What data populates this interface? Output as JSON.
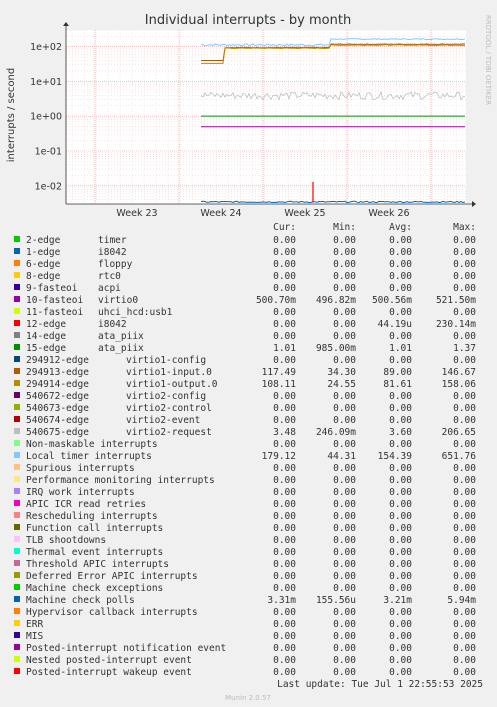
{
  "chart_data": {
    "type": "line",
    "title": "Individual interrupts - by month",
    "ylabel": "interrupts / second",
    "yscale": "log",
    "ylim": [
      0.003,
      300
    ],
    "y_ticks": [
      "1e+02",
      "1e+01",
      "1e+00",
      "1e-01",
      "1e-02"
    ],
    "x_ticks": [
      "Week 23",
      "Week 24",
      "Week 25",
      "Week 26"
    ],
    "side_label": "RRDTOOL / TOBI OETIKER",
    "column_headers": [
      "Cur:",
      "Min:",
      "Avg:",
      "Max:"
    ],
    "series": [
      {
        "name": "2-edge",
        "device": "timer",
        "color": "#00cc00",
        "cur": "0.00",
        "min": "0.00",
        "avg": "0.00",
        "max": "0.00"
      },
      {
        "name": "1-edge",
        "device": "i8042",
        "color": "#0066b3",
        "cur": "0.00",
        "min": "0.00",
        "avg": "0.00",
        "max": "0.00"
      },
      {
        "name": "6-edge",
        "device": "floppy",
        "color": "#ff8000",
        "cur": "0.00",
        "min": "0.00",
        "avg": "0.00",
        "max": "0.00"
      },
      {
        "name": "8-edge",
        "device": "rtc0",
        "color": "#ffcc00",
        "cur": "0.00",
        "min": "0.00",
        "avg": "0.00",
        "max": "0.00"
      },
      {
        "name": "9-fasteoi",
        "device": "acpi",
        "color": "#330099",
        "cur": "0.00",
        "min": "0.00",
        "avg": "0.00",
        "max": "0.00"
      },
      {
        "name": "10-fasteoi",
        "device": "virtio0",
        "color": "#990099",
        "cur": "500.70m",
        "min": "496.82m",
        "avg": "500.56m",
        "max": "521.50m"
      },
      {
        "name": "11-fasteoi",
        "device": "uhci_hcd:usb1",
        "color": "#ccff00",
        "cur": "0.00",
        "min": "0.00",
        "avg": "0.00",
        "max": "0.00"
      },
      {
        "name": "12-edge",
        "device": "i8042",
        "color": "#ff0000",
        "cur": "0.00",
        "min": "0.00",
        "avg": "44.19u",
        "max": "230.14m"
      },
      {
        "name": "14-edge",
        "device": "ata_piix",
        "color": "#808080",
        "cur": "0.00",
        "min": "0.00",
        "avg": "0.00",
        "max": "0.00"
      },
      {
        "name": "15-edge",
        "device": "ata_piix",
        "color": "#008f00",
        "cur": "1.01",
        "min": "985.00m",
        "avg": "1.01",
        "max": "1.37"
      },
      {
        "name": "294912-edge",
        "device": "virtio1-config",
        "color": "#00487d",
        "cur": "0.00",
        "min": "0.00",
        "avg": "0.00",
        "max": "0.00"
      },
      {
        "name": "294913-edge",
        "device": "virtio1-input.0",
        "color": "#b35a00",
        "cur": "117.49",
        "min": "34.30",
        "avg": "89.00",
        "max": "146.67"
      },
      {
        "name": "294914-edge",
        "device": "virtio1-output.0",
        "color": "#b38f00",
        "cur": "108.11",
        "min": "24.55",
        "avg": "81.61",
        "max": "158.06"
      },
      {
        "name": "540672-edge",
        "device": "virtio2-config",
        "color": "#6b006b",
        "cur": "0.00",
        "min": "0.00",
        "avg": "0.00",
        "max": "0.00"
      },
      {
        "name": "540673-edge",
        "device": "virtio2-control",
        "color": "#8fb300",
        "cur": "0.00",
        "min": "0.00",
        "avg": "0.00",
        "max": "0.00"
      },
      {
        "name": "540674-edge",
        "device": "virtio2-event",
        "color": "#b30000",
        "cur": "0.00",
        "min": "0.00",
        "avg": "0.00",
        "max": "0.00"
      },
      {
        "name": "540675-edge",
        "device": "virtio2-request",
        "color": "#bebebe",
        "cur": "3.48",
        "min": "246.09m",
        "avg": "3.60",
        "max": "206.65"
      },
      {
        "name": "Non-maskable interrupts",
        "device": "",
        "color": "#80ff80",
        "cur": "0.00",
        "min": "0.00",
        "avg": "0.00",
        "max": "0.00"
      },
      {
        "name": "Local timer interrupts",
        "device": "",
        "color": "#80c9ff",
        "cur": "179.12",
        "min": "44.31",
        "avg": "154.39",
        "max": "651.76"
      },
      {
        "name": "Spurious interrupts",
        "device": "",
        "color": "#ffc080",
        "cur": "0.00",
        "min": "0.00",
        "avg": "0.00",
        "max": "0.00"
      },
      {
        "name": "Performance monitoring interrupts",
        "device": "",
        "color": "#ffe680",
        "cur": "0.00",
        "min": "0.00",
        "avg": "0.00",
        "max": "0.00"
      },
      {
        "name": "IRQ work interrupts",
        "device": "",
        "color": "#aa80ff",
        "cur": "0.00",
        "min": "0.00",
        "avg": "0.00",
        "max": "0.00"
      },
      {
        "name": "APIC ICR read retries",
        "device": "",
        "color": "#ee00cc",
        "cur": "0.00",
        "min": "0.00",
        "avg": "0.00",
        "max": "0.00"
      },
      {
        "name": "Rescheduling interrupts",
        "device": "",
        "color": "#ff8080",
        "cur": "0.00",
        "min": "0.00",
        "avg": "0.00",
        "max": "0.00"
      },
      {
        "name": "Function call interrupts",
        "device": "",
        "color": "#666600",
        "cur": "0.00",
        "min": "0.00",
        "avg": "0.00",
        "max": "0.00"
      },
      {
        "name": "TLB shootdowns",
        "device": "",
        "color": "#ffbfff",
        "cur": "0.00",
        "min": "0.00",
        "avg": "0.00",
        "max": "0.00"
      },
      {
        "name": "Thermal event interrupts",
        "device": "",
        "color": "#00ffcc",
        "cur": "0.00",
        "min": "0.00",
        "avg": "0.00",
        "max": "0.00"
      },
      {
        "name": "Threshold APIC interrupts",
        "device": "",
        "color": "#cc6699",
        "cur": "0.00",
        "min": "0.00",
        "avg": "0.00",
        "max": "0.00"
      },
      {
        "name": "Deferred Error APIC interrupts",
        "device": "",
        "color": "#999900",
        "cur": "0.00",
        "min": "0.00",
        "avg": "0.00",
        "max": "0.00"
      },
      {
        "name": "Machine check exceptions",
        "device": "",
        "color": "#00cc00",
        "cur": "0.00",
        "min": "0.00",
        "avg": "0.00",
        "max": "0.00"
      },
      {
        "name": "Machine check polls",
        "device": "",
        "color": "#0066b3",
        "cur": "3.31m",
        "min": "155.56u",
        "avg": "3.21m",
        "max": "5.94m"
      },
      {
        "name": "Hypervisor callback interrupts",
        "device": "",
        "color": "#ff8000",
        "cur": "0.00",
        "min": "0.00",
        "avg": "0.00",
        "max": "0.00"
      },
      {
        "name": "ERR",
        "device": "",
        "color": "#ffcc00",
        "cur": "0.00",
        "min": "0.00",
        "avg": "0.00",
        "max": "0.00"
      },
      {
        "name": "MIS",
        "device": "",
        "color": "#330099",
        "cur": "0.00",
        "min": "0.00",
        "avg": "0.00",
        "max": "0.00"
      },
      {
        "name": "Posted-interrupt notification event",
        "device": "",
        "color": "#990099",
        "cur": "0.00",
        "min": "0.00",
        "avg": "0.00",
        "max": "0.00"
      },
      {
        "name": "Nested posted-interrupt event",
        "device": "",
        "color": "#ccff00",
        "cur": "0.00",
        "min": "0.00",
        "avg": "0.00",
        "max": "0.00"
      },
      {
        "name": "Posted-interrupt wakeup event",
        "device": "",
        "color": "#ff0000",
        "cur": "0.00",
        "min": "0.00",
        "avg": "0.00",
        "max": "0.00"
      }
    ],
    "last_update": "Last update: Tue Jul  1 22:55:53 2025",
    "footer": "Munin 2.0.57"
  }
}
